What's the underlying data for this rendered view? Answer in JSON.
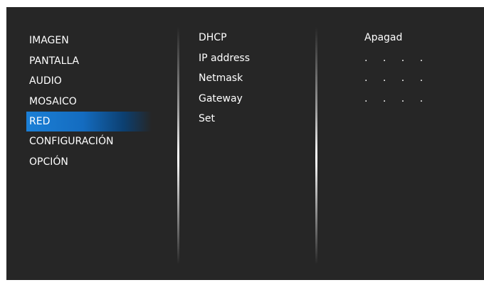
{
  "menu": {
    "items": [
      {
        "label": "IMAGEN"
      },
      {
        "label": "PANTALLA"
      },
      {
        "label": "AUDIO"
      },
      {
        "label": "MOSAICO"
      },
      {
        "label": "RED",
        "selected": true
      },
      {
        "label": "CONFIGURACIÓN"
      },
      {
        "label": "OPCIÓN"
      }
    ]
  },
  "submenu": {
    "items": [
      {
        "label": "DHCP"
      },
      {
        "label": "IP address"
      },
      {
        "label": "Netmask"
      },
      {
        "label": "Gateway"
      },
      {
        "label": "Set"
      }
    ]
  },
  "values": {
    "dhcp": "Apagad",
    "ip_address": ". . . .",
    "netmask": ". . . .",
    "gateway": ". . . ."
  },
  "colors": {
    "background": "#262626",
    "selected": "#1b7fd6",
    "text": "#ffffff"
  }
}
